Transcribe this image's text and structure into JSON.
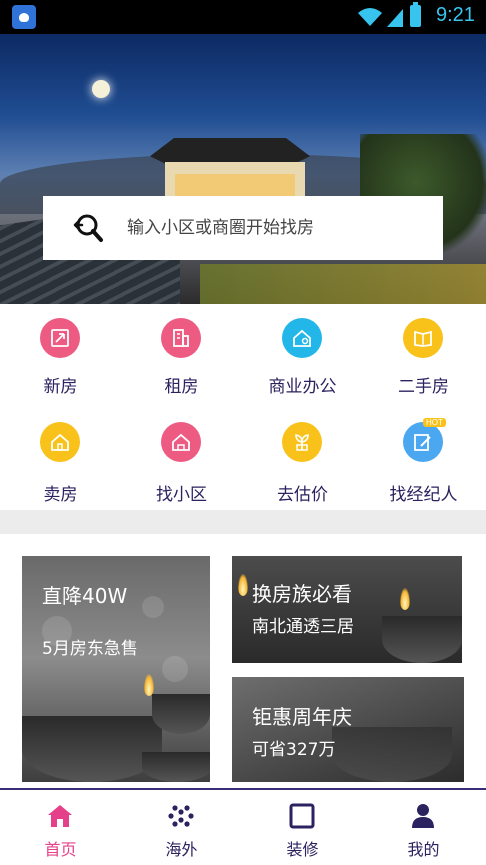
{
  "status_bar": {
    "time": "9:21"
  },
  "search": {
    "placeholder": "输入小区或商圈开始找房"
  },
  "categories": [
    {
      "label": "新房",
      "icon": "new-house-icon",
      "color": "#ee5b82"
    },
    {
      "label": "租房",
      "icon": "rent-building-icon",
      "color": "#ee5b82"
    },
    {
      "label": "商业办公",
      "icon": "office-house-icon",
      "color": "#22b7e8"
    },
    {
      "label": "二手房",
      "icon": "secondhand-book-icon",
      "color": "#f8c21a"
    },
    {
      "label": "卖房",
      "icon": "sell-house-icon",
      "color": "#f8c21a"
    },
    {
      "label": "找小区",
      "icon": "community-house-icon",
      "color": "#ee5b82"
    },
    {
      "label": "去估价",
      "icon": "valuation-plant-icon",
      "color": "#f8c21a"
    },
    {
      "label": "找经纪人",
      "icon": "agent-edit-icon",
      "color": "#4aa7f0",
      "badge": "HOT"
    }
  ],
  "promos": [
    {
      "title": "直降40W",
      "subtitle": "5月房东急售"
    },
    {
      "title": "换房族必看",
      "subtitle": "南北通透三居"
    },
    {
      "title": "钜惠周年庆",
      "subtitle": "可省327万"
    }
  ],
  "tabs": [
    {
      "label": "首页",
      "icon": "home-icon",
      "active": true
    },
    {
      "label": "海外",
      "icon": "overseas-dots-icon",
      "active": false
    },
    {
      "label": "装修",
      "icon": "decoration-square-icon",
      "active": false
    },
    {
      "label": "我的",
      "icon": "profile-person-icon",
      "active": false
    }
  ],
  "colors": {
    "accent": "#e5418b",
    "primary_text": "#2b2260",
    "tab_border": "#3b2c7a"
  }
}
